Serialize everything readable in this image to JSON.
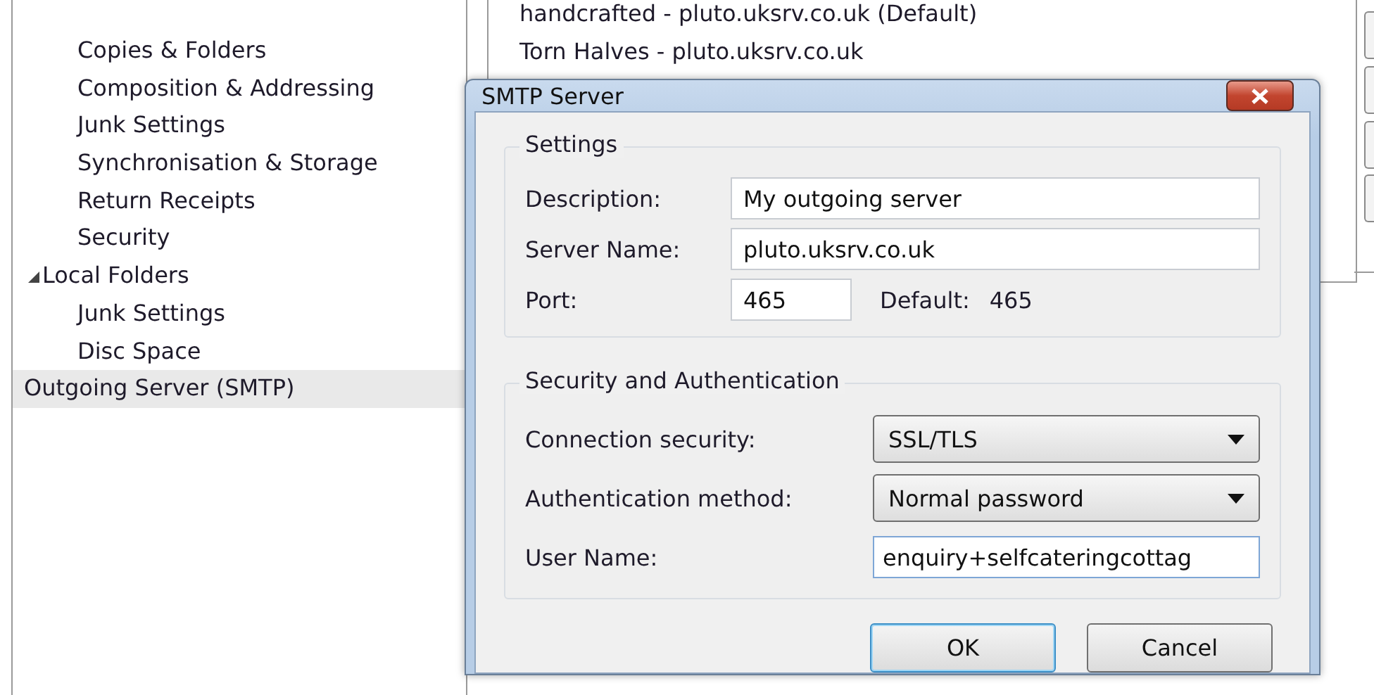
{
  "tree": [
    {
      "children": [
        {
          "label": "Copies & Folders",
          "selected": false
        },
        {
          "label": "Composition & Addressing",
          "selected": false
        },
        {
          "label": "Junk Settings",
          "selected": false
        },
        {
          "label": "Synchronisation & Storage",
          "selected": false
        },
        {
          "label": "Return Receipts",
          "selected": false
        },
        {
          "label": "Security",
          "selected": false
        }
      ]
    },
    {
      "label": "Local Folders",
      "expanded": true,
      "selected": false,
      "children": [
        {
          "label": "Junk Settings",
          "selected": false
        },
        {
          "label": "Disc Space",
          "selected": false
        }
      ]
    },
    {
      "label": "Outgoing Server (SMTP)",
      "selected": true
    }
  ],
  "server_list": [
    {
      "label": "handcrafted - pluto.uksrv.co.uk (Default)",
      "selected": false
    },
    {
      "label": "Torn Halves - pluto.uksrv.co.uk",
      "selected": false
    }
  ],
  "dialog": {
    "title": "SMTP Server",
    "settings": {
      "title": "Settings",
      "description": {
        "label": "Description:",
        "value": "My outgoing server"
      },
      "server_name": {
        "label": "Server Name:",
        "value": "pluto.uksrv.co.uk"
      },
      "port": {
        "label": "Port:",
        "value": "465",
        "default_label": "Default:",
        "default_value": "465"
      }
    },
    "security": {
      "title": "Security and Authentication",
      "connection_security": {
        "label": "Connection security:",
        "value": "SSL/TLS"
      },
      "authentication_method": {
        "label": "Authentication method:",
        "value": "Normal password"
      },
      "user_name": {
        "label": "User Name:",
        "value": "enquiry+selfcateringcottag"
      }
    },
    "buttons": [
      {
        "label": "OK",
        "default": true
      },
      {
        "label": "Cancel",
        "default": false
      }
    ]
  }
}
